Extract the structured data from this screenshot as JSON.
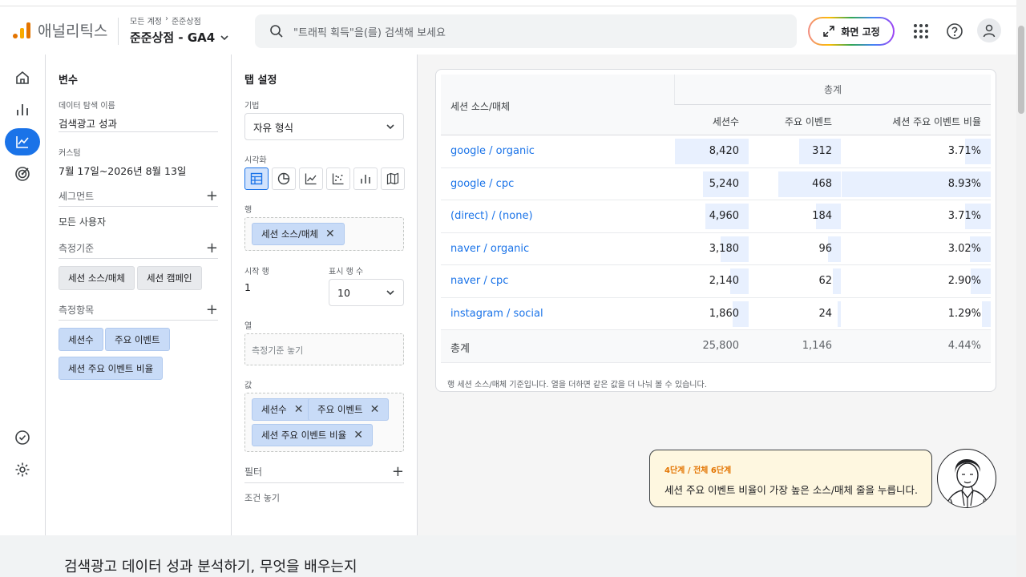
{
  "header": {
    "brand": "애널리틱스",
    "breadcrumb": [
      "모든 계정",
      "준준상점"
    ],
    "property": "준준상점 - GA4",
    "search_placeholder": "\"트래픽 획득\"을(를) 검색해 보세요",
    "fix_button": "화면 고정",
    "icons": [
      "apps-icon",
      "help-icon",
      "account-icon"
    ]
  },
  "leftnav": {
    "items": [
      "home-icon",
      "reports-icon",
      "explore-icon",
      "advertising-icon",
      "admin-check-icon",
      "settings-icon"
    ],
    "active": "explore-icon"
  },
  "variables": {
    "title": "변수",
    "exploration_name_label": "데이터 탐색 이름",
    "exploration_name": "검색광고 성과",
    "date_label": "커스텀",
    "date_range": "7월 17일~2026년 8월 13일",
    "segments_label": "세그먼트",
    "segment_value": "모든 사용자",
    "dimensions_label": "측정기준",
    "dimensions": [
      "세션 소스/매체",
      "세션 캠페인"
    ],
    "metrics_label": "측정항목",
    "metrics": [
      "세션수",
      "주요 이벤트",
      "세션 주요 이벤트 비율"
    ]
  },
  "tab_settings": {
    "title": "탭 설정",
    "technique_label": "기법",
    "technique": "자유 형식",
    "viz_label": "시각화",
    "rows_label": "행",
    "rows": [
      "세션 소스/매체"
    ],
    "start_row_label": "시작 행",
    "start_row": "1",
    "show_rows_label": "표시 행 수",
    "show_rows": "10",
    "columns_label": "열",
    "columns_placeholder": "측정기준 놓기",
    "values_label": "값",
    "values": [
      "세션수",
      "주요 이벤트",
      "세션 주요 이벤트 비율"
    ],
    "filter_label": "필터",
    "filter_placeholder": "조건 놓기"
  },
  "table": {
    "dimension_header": "세션 소스/매체",
    "group_header": "총계",
    "metric_headers": [
      "세션수",
      "주요 이벤트",
      "세션 주요 이벤트 비율"
    ],
    "rows": [
      {
        "dim": "google / organic",
        "sessions": "8,420",
        "events": "312",
        "rate": "3.71%"
      },
      {
        "dim": "google / cpc",
        "sessions": "5,240",
        "events": "468",
        "rate": "8.93%"
      },
      {
        "dim": "(direct) / (none)",
        "sessions": "4,960",
        "events": "184",
        "rate": "3.71%"
      },
      {
        "dim": "naver / organic",
        "sessions": "3,180",
        "events": "96",
        "rate": "3.02%"
      },
      {
        "dim": "naver / cpc",
        "sessions": "2,140",
        "events": "62",
        "rate": "2.90%"
      },
      {
        "dim": "instagram / social",
        "sessions": "1,860",
        "events": "24",
        "rate": "1.29%"
      }
    ],
    "total": {
      "dim": "총계",
      "sessions": "25,800",
      "events": "1,146",
      "rate": "4.44%"
    },
    "footnote": "행 세션 소스/매체 기준입니다. 열을 더하면 같은 값을 더 나눠 볼 수 있습니다."
  },
  "tooltip": {
    "step": "4단계 / 전체 6단계",
    "message": "세션 주요 이벤트 비율이 가장 높은 소스/매체 줄을 누릅니다."
  },
  "bottom": {
    "title": "검색광고 데이터 성과 분석하기, 무엇을 배우는지"
  }
}
